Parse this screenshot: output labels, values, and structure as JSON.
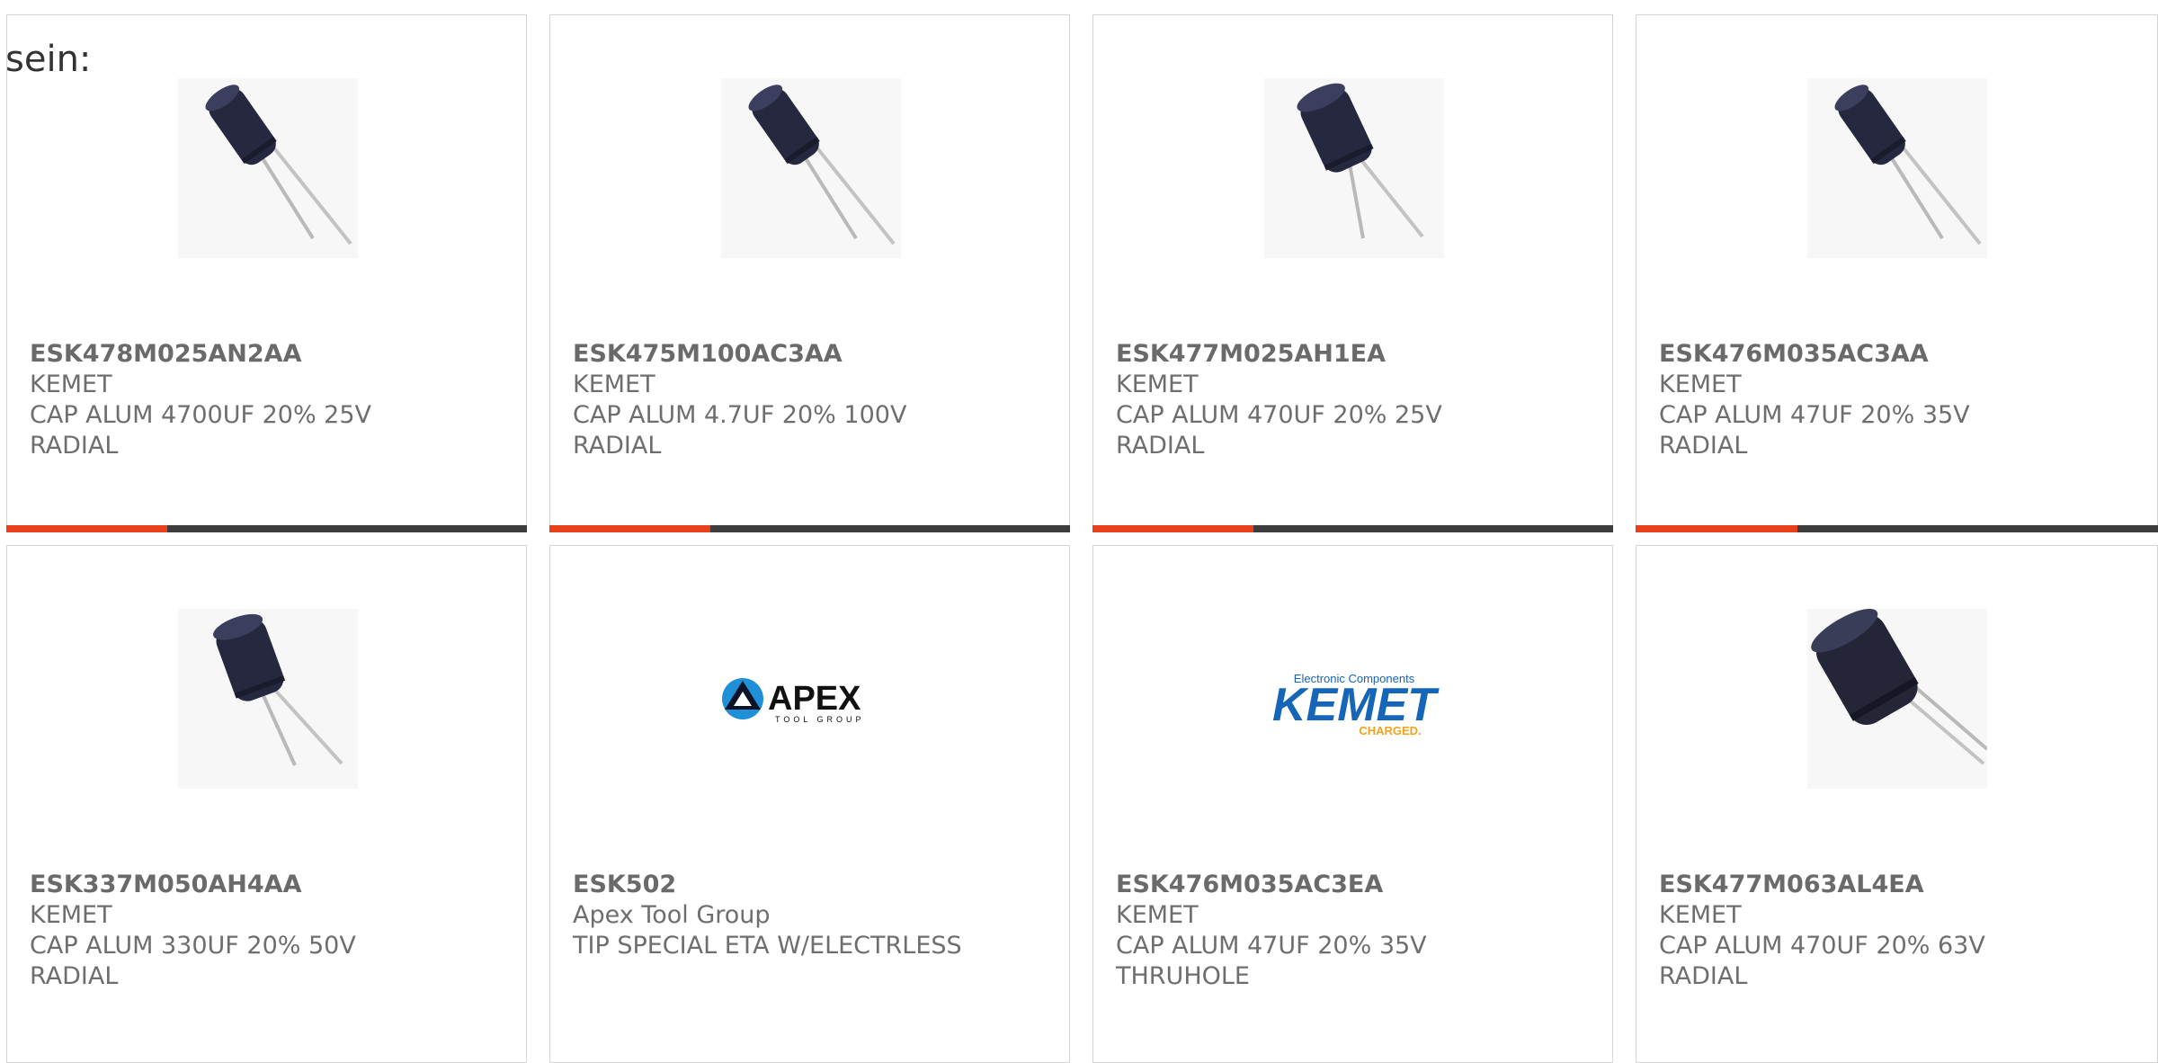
{
  "intro_text": "sein:",
  "colors": {
    "accent": "#e8401a",
    "bar_dark": "#3d3d3d",
    "border": "#d4d4d4",
    "text": "#6e6e6e"
  },
  "products": [
    {
      "part_number": "ESK478M025AN2AA",
      "manufacturer": "KEMET",
      "description": "CAP ALUM 4700UF 20% 25V",
      "package": "RADIAL",
      "image": "capacitor-radial-icon",
      "bar_fill_fraction": 0.31
    },
    {
      "part_number": "ESK475M100AC3AA",
      "manufacturer": "KEMET",
      "description": "CAP ALUM 4.7UF 20% 100V",
      "package": "RADIAL",
      "image": "capacitor-radial-icon",
      "bar_fill_fraction": 0.31
    },
    {
      "part_number": "ESK477M025AH1EA",
      "manufacturer": "KEMET",
      "description": "CAP ALUM 470UF 20% 25V",
      "package": "RADIAL",
      "image": "capacitor-radial-icon",
      "bar_fill_fraction": 0.31
    },
    {
      "part_number": "ESK476M035AC3AA",
      "manufacturer": "KEMET",
      "description": "CAP ALUM 47UF 20% 35V",
      "package": "RADIAL",
      "image": "capacitor-radial-icon",
      "bar_fill_fraction": 0.31
    },
    {
      "part_number": "ESK337M050AH4AA",
      "manufacturer": "KEMET",
      "description": "CAP ALUM 330UF 20% 50V",
      "package": "RADIAL",
      "image": "capacitor-radial-icon"
    },
    {
      "part_number": "ESK502",
      "manufacturer": "Apex Tool Group",
      "description": "TIP SPECIAL ETA W/ELECTRLESS",
      "package": "",
      "image": "apex-tool-group-logo",
      "logo_text": "APEX",
      "logo_subtext": "TOOL GROUP"
    },
    {
      "part_number": "ESK476M035AC3EA",
      "manufacturer": "KEMET",
      "description": "CAP ALUM 47UF 20% 35V",
      "package": "THRUHOLE",
      "image": "kemet-logo",
      "logo_top": "Electronic Components",
      "logo_text": "KEMET",
      "logo_tagline": "CHARGED."
    },
    {
      "part_number": "ESK477M063AL4EA",
      "manufacturer": "KEMET",
      "description": "CAP ALUM 470UF 20% 63V",
      "package": "RADIAL",
      "image": "capacitor-radial-large-icon"
    }
  ]
}
